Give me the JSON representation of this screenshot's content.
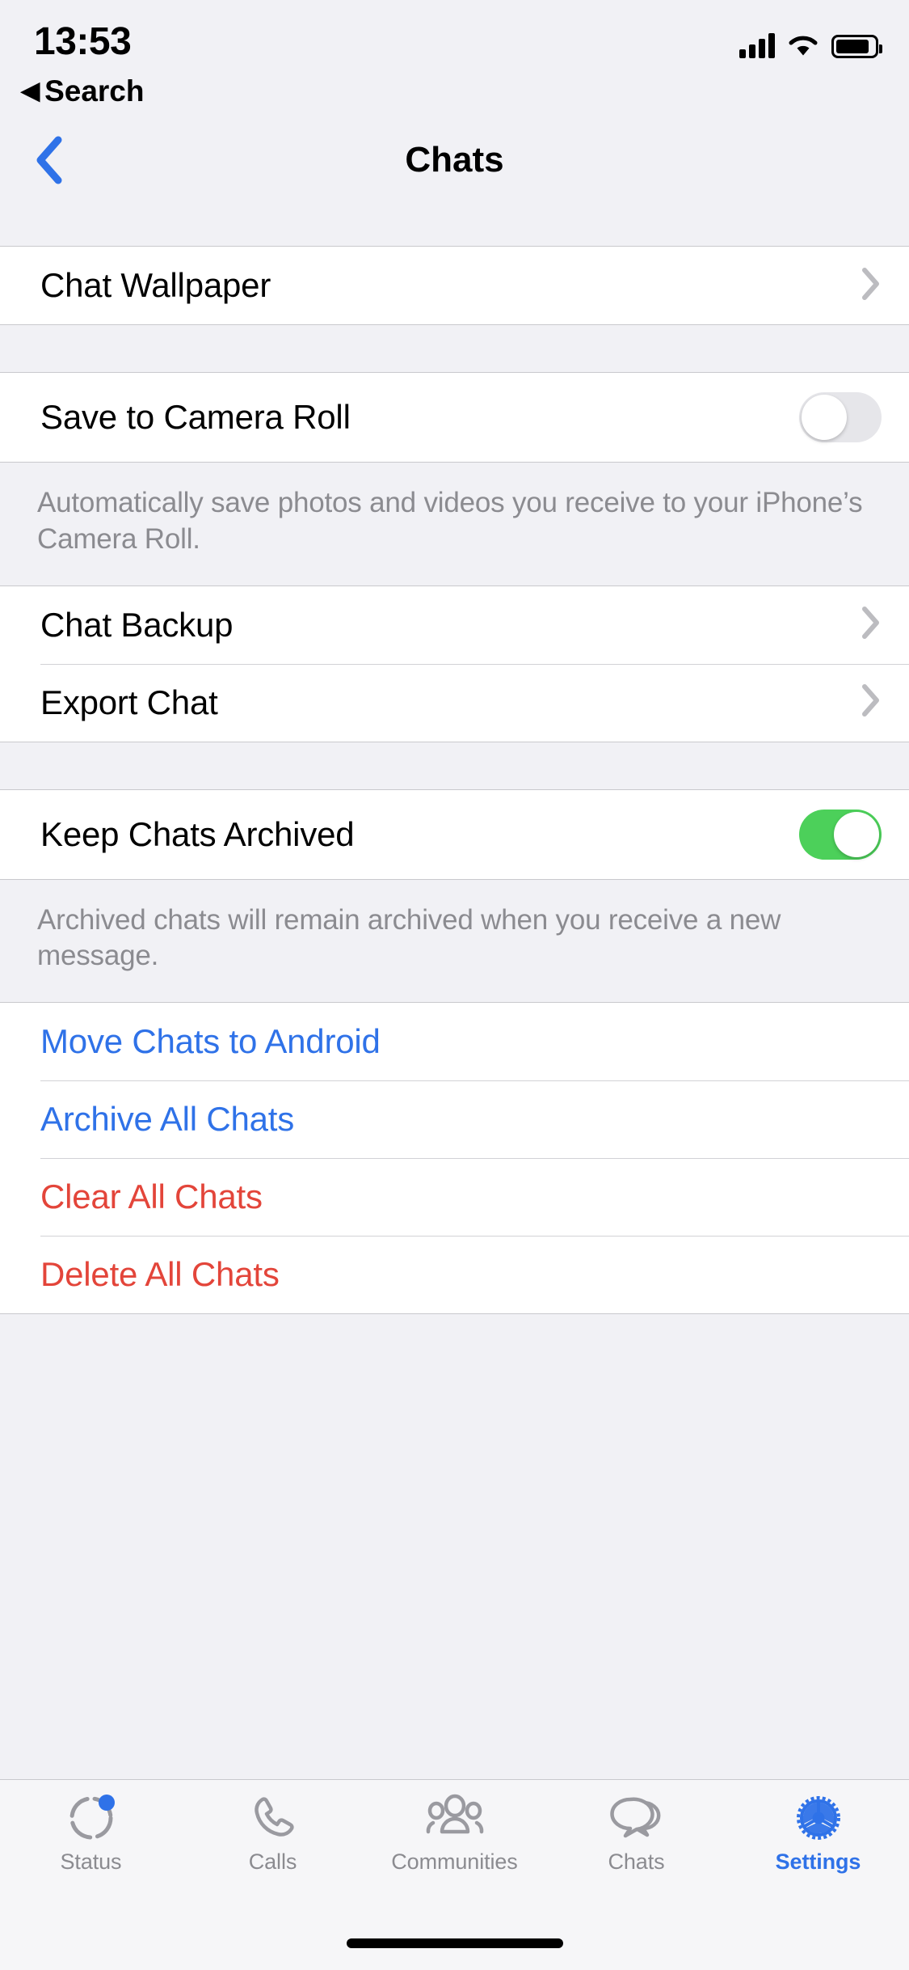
{
  "status_bar": {
    "time": "13:53",
    "back_label": "Search",
    "back_triangle": "◀",
    "icons": {
      "cellular": "signal-bars-icon",
      "wifi": "wifi-icon",
      "battery": "battery-icon"
    }
  },
  "nav": {
    "title": "Chats",
    "back_icon": "chevron-left-icon"
  },
  "sections": {
    "wallpaper": {
      "label": "Chat Wallpaper",
      "accessory": "chevron-right-icon"
    },
    "camera_roll": {
      "label": "Save to Camera Roll",
      "toggle_state": "off",
      "footer": "Automatically save photos and videos you receive to your iPhone’s Camera Roll."
    },
    "backup": {
      "items": [
        {
          "label": "Chat Backup",
          "accessory": "chevron-right-icon"
        },
        {
          "label": "Export Chat",
          "accessory": "chevron-right-icon"
        }
      ]
    },
    "archived": {
      "label": "Keep Chats Archived",
      "toggle_state": "on",
      "footer": "Archived chats will remain archived when you receive a new message."
    },
    "actions": {
      "items": [
        {
          "label": "Move Chats to Android",
          "style": "blue"
        },
        {
          "label": "Archive All Chats",
          "style": "blue"
        },
        {
          "label": "Clear All Chats",
          "style": "red"
        },
        {
          "label": "Delete All Chats",
          "style": "red"
        }
      ]
    }
  },
  "tabbar": {
    "items": [
      {
        "label": "Status",
        "icon": "status-ring-icon",
        "active": false,
        "badge": true
      },
      {
        "label": "Calls",
        "icon": "phone-icon",
        "active": false,
        "badge": false
      },
      {
        "label": "Communities",
        "icon": "communities-icon",
        "active": false,
        "badge": false
      },
      {
        "label": "Chats",
        "icon": "chat-bubbles-icon",
        "active": false,
        "badge": false
      },
      {
        "label": "Settings",
        "icon": "gear-icon",
        "active": true,
        "badge": false
      }
    ]
  },
  "colors": {
    "accent_blue": "#2f72e8",
    "destructive_red": "#e3453a",
    "toggle_on_green": "#4cd05a",
    "toggle_off_gray": "#e6e6ea",
    "group_background": "#f1f1f5",
    "row_background": "#ffffff",
    "secondary_text": "#8b8b90"
  }
}
